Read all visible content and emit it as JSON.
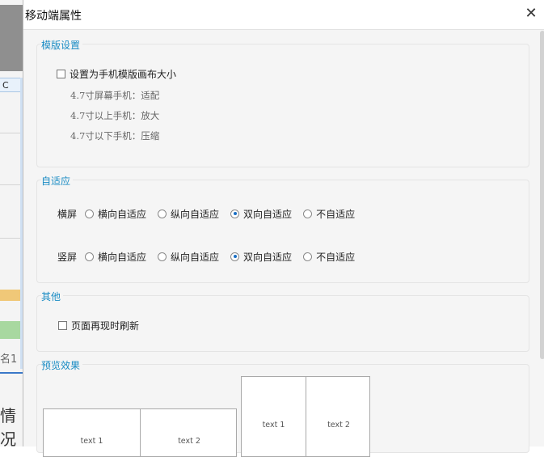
{
  "dialog": {
    "title": "移动端属性"
  },
  "background": {
    "c_label": "C",
    "name_label": "名1",
    "qing_label": "情况"
  },
  "template_settings": {
    "legend": "模版设置",
    "checkbox_label": "设置为手机模版画布大小",
    "checked": false,
    "notes": [
      "4.7寸屏幕手机：适配",
      "4.7寸以上手机：放大",
      "4.7寸以下手机：压缩"
    ]
  },
  "adaptive": {
    "legend": "自适应",
    "rows": [
      {
        "label": "横屏",
        "options": [
          "横向自适应",
          "纵向自适应",
          "双向自适应",
          "不自适应"
        ],
        "selected": 2
      },
      {
        "label": "竖屏",
        "options": [
          "横向自适应",
          "纵向自适应",
          "双向自适应",
          "不自适应"
        ],
        "selected": 2
      }
    ]
  },
  "other": {
    "legend": "其他",
    "checkbox_label": "页面再现时刷新",
    "checked": false
  },
  "preview": {
    "legend": "预览效果",
    "landscape": [
      "text 1",
      "text 2"
    ],
    "portrait": [
      "text 1",
      "text 2"
    ]
  }
}
